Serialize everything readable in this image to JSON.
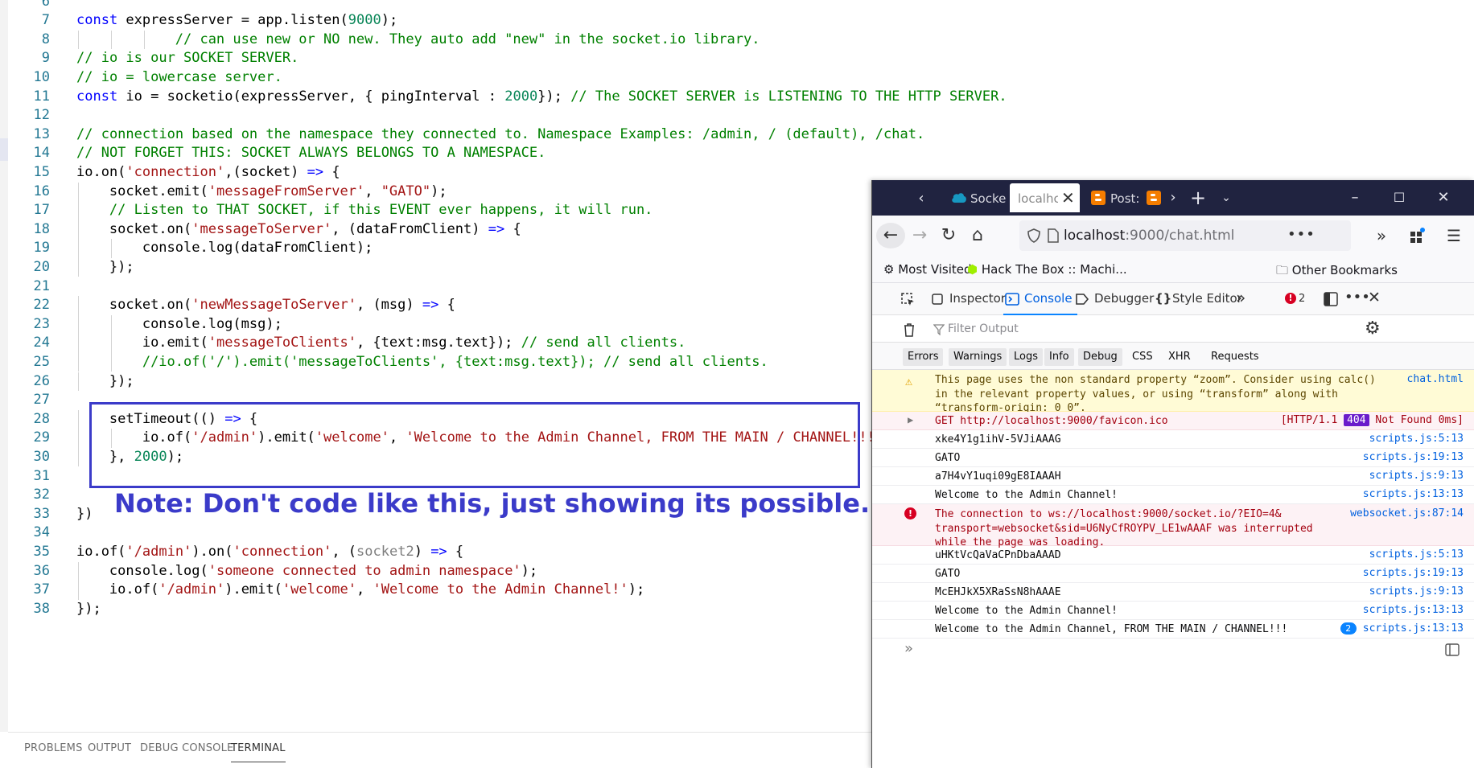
{
  "editor": {
    "lines": [
      {
        "num": "6",
        "indent": 0,
        "segments": []
      },
      {
        "num": "7",
        "indent": 0,
        "segments": [
          {
            "t": "const",
            "c": "kw"
          },
          {
            "t": " expressServer = app.listen(",
            "c": ""
          },
          {
            "t": "9000",
            "c": "num"
          },
          {
            "t": ");",
            "c": ""
          }
        ]
      },
      {
        "num": "8",
        "indent": 3,
        "segments": [
          {
            "t": "// can use new or NO new. They auto add \"new\" in the socket.io library.",
            "c": "cm"
          }
        ]
      },
      {
        "num": "9",
        "indent": 0,
        "segments": [
          {
            "t": "// io is our SOCKET SERVER.",
            "c": "cm"
          }
        ]
      },
      {
        "num": "10",
        "indent": 0,
        "segments": [
          {
            "t": "// io = lowercase server.",
            "c": "cm"
          }
        ]
      },
      {
        "num": "11",
        "indent": 0,
        "segments": [
          {
            "t": "const",
            "c": "kw"
          },
          {
            "t": " io = socketio(expressServer, { pingInterval : ",
            "c": ""
          },
          {
            "t": "2000",
            "c": "num"
          },
          {
            "t": "}); ",
            "c": ""
          },
          {
            "t": "// The SOCKET SERVER is LISTENING TO THE HTTP SERVER.",
            "c": "cm"
          }
        ]
      },
      {
        "num": "12",
        "indent": 0,
        "segments": []
      },
      {
        "num": "13",
        "indent": 0,
        "segments": [
          {
            "t": "// connection based on the namespace they connected to. Namespace Examples: /admin, / (default), /chat.",
            "c": "cm"
          }
        ]
      },
      {
        "num": "14",
        "indent": 0,
        "segments": [
          {
            "t": "// NOT FORGET THIS: SOCKET ALWAYS BELONGS TO A NAMESPACE.",
            "c": "cm"
          }
        ]
      },
      {
        "num": "15",
        "indent": 0,
        "segments": [
          {
            "t": "io.on(",
            "c": ""
          },
          {
            "t": "'connection'",
            "c": "str"
          },
          {
            "t": ",(socket) ",
            "c": ""
          },
          {
            "t": "=>",
            "c": "kw"
          },
          {
            "t": " {",
            "c": ""
          }
        ]
      },
      {
        "num": "16",
        "indent": 1,
        "segments": [
          {
            "t": "socket.emit(",
            "c": ""
          },
          {
            "t": "'messageFromServer'",
            "c": "str"
          },
          {
            "t": ", ",
            "c": ""
          },
          {
            "t": "\"GATO\"",
            "c": "str"
          },
          {
            "t": ");",
            "c": ""
          }
        ]
      },
      {
        "num": "17",
        "indent": 1,
        "segments": [
          {
            "t": "// Listen to THAT SOCKET, if this EVENT ever happens, it will run.",
            "c": "cm"
          }
        ]
      },
      {
        "num": "18",
        "indent": 1,
        "segments": [
          {
            "t": "socket.on(",
            "c": ""
          },
          {
            "t": "'messageToServer'",
            "c": "str"
          },
          {
            "t": ", (dataFromClient) ",
            "c": ""
          },
          {
            "t": "=>",
            "c": "kw"
          },
          {
            "t": " {",
            "c": ""
          }
        ]
      },
      {
        "num": "19",
        "indent": 2,
        "segments": [
          {
            "t": "console.log(dataFromClient);",
            "c": ""
          }
        ]
      },
      {
        "num": "20",
        "indent": 1,
        "segments": [
          {
            "t": "});",
            "c": ""
          }
        ]
      },
      {
        "num": "21",
        "indent": 0,
        "segments": []
      },
      {
        "num": "22",
        "indent": 1,
        "segments": [
          {
            "t": "socket.on(",
            "c": ""
          },
          {
            "t": "'newMessageToServer'",
            "c": "str"
          },
          {
            "t": ", (msg) ",
            "c": ""
          },
          {
            "t": "=>",
            "c": "kw"
          },
          {
            "t": " {",
            "c": ""
          }
        ]
      },
      {
        "num": "23",
        "indent": 2,
        "segments": [
          {
            "t": "console.log(msg);",
            "c": ""
          }
        ]
      },
      {
        "num": "24",
        "indent": 2,
        "segments": [
          {
            "t": "io.emit(",
            "c": ""
          },
          {
            "t": "'messageToClients'",
            "c": "str"
          },
          {
            "t": ", {text:msg.text}); ",
            "c": ""
          },
          {
            "t": "// send all clients.",
            "c": "cm"
          }
        ]
      },
      {
        "num": "25",
        "indent": 2,
        "segments": [
          {
            "t": "//io.of('/').emit('messageToClients', {text:msg.text}); // send all clients.",
            "c": "cm"
          }
        ]
      },
      {
        "num": "26",
        "indent": 1,
        "segments": [
          {
            "t": "});",
            "c": ""
          }
        ]
      },
      {
        "num": "27",
        "indent": 0,
        "segments": []
      },
      {
        "num": "28",
        "indent": 1,
        "segments": [
          {
            "t": "setTimeout(() ",
            "c": ""
          },
          {
            "t": "=>",
            "c": "kw"
          },
          {
            "t": " {",
            "c": ""
          }
        ]
      },
      {
        "num": "29",
        "indent": 2,
        "segments": [
          {
            "t": "io.of(",
            "c": ""
          },
          {
            "t": "'/admin'",
            "c": "str"
          },
          {
            "t": ").emit(",
            "c": ""
          },
          {
            "t": "'welcome'",
            "c": "str"
          },
          {
            "t": ", ",
            "c": ""
          },
          {
            "t": "'Welcome to the Admin Channel, FROM THE MAIN / CHANNEL!!!'",
            "c": "str"
          },
          {
            "t": ");",
            "c": ""
          }
        ]
      },
      {
        "num": "30",
        "indent": 1,
        "segments": [
          {
            "t": "}, ",
            "c": ""
          },
          {
            "t": "2000",
            "c": "num"
          },
          {
            "t": ");",
            "c": ""
          }
        ]
      },
      {
        "num": "31",
        "indent": 0,
        "segments": []
      },
      {
        "num": "32",
        "indent": 0,
        "segments": []
      },
      {
        "num": "33",
        "indent": 0,
        "segments": [
          {
            "t": "})",
            "c": ""
          }
        ]
      },
      {
        "num": "34",
        "indent": 0,
        "segments": []
      },
      {
        "num": "35",
        "indent": 0,
        "segments": [
          {
            "t": "io.of(",
            "c": ""
          },
          {
            "t": "'/admin'",
            "c": "str"
          },
          {
            "t": ").on(",
            "c": ""
          },
          {
            "t": "'connection'",
            "c": "str"
          },
          {
            "t": ", (",
            "c": ""
          },
          {
            "t": "socket2",
            "c": "dim"
          },
          {
            "t": ") ",
            "c": ""
          },
          {
            "t": "=>",
            "c": "kw"
          },
          {
            "t": " {",
            "c": ""
          }
        ]
      },
      {
        "num": "36",
        "indent": 1,
        "segments": [
          {
            "t": "console.log(",
            "c": ""
          },
          {
            "t": "'someone connected to admin namespace'",
            "c": "str"
          },
          {
            "t": ");",
            "c": ""
          }
        ]
      },
      {
        "num": "37",
        "indent": 1,
        "segments": [
          {
            "t": "io.of(",
            "c": ""
          },
          {
            "t": "'/admin'",
            "c": "str"
          },
          {
            "t": ").emit(",
            "c": ""
          },
          {
            "t": "'welcome'",
            "c": "str"
          },
          {
            "t": ", ",
            "c": ""
          },
          {
            "t": "'Welcome to the Admin Channel!'",
            "c": "str"
          },
          {
            "t": ");",
            "c": ""
          }
        ]
      },
      {
        "num": "38",
        "indent": 0,
        "segments": [
          {
            "t": "});",
            "c": ""
          }
        ]
      }
    ],
    "note": "Note: Don't code like this, just showing its possible."
  },
  "panel": {
    "tabs": [
      "PROBLEMS",
      "OUTPUT",
      "DEBUG CONSOLE",
      "TERMINAL"
    ],
    "active": "TERMINAL"
  },
  "browser": {
    "tabs": [
      {
        "label": "Socke",
        "icon": "salesforce-cloud-icon"
      },
      {
        "label": "localhc",
        "icon": "none",
        "active": true
      },
      {
        "label": "Post: E",
        "icon": "blogger-icon"
      },
      {
        "label": "",
        "icon": "blogger-icon"
      }
    ],
    "url_host": "localhost",
    "url_rest": ":9000/chat.html",
    "bookmarks": {
      "most_visited": "Most Visited",
      "htb": "Hack The Box :: Machi...",
      "other": "Other Bookmarks"
    },
    "devtools": {
      "tabs": [
        "Inspector",
        "Console",
        "Debugger",
        "Style Editor"
      ],
      "active_tab": "Console",
      "error_count": "2",
      "filter_placeholder": "Filter Output",
      "levels": [
        "Errors",
        "Warnings",
        "Logs",
        "Info",
        "Debug"
      ],
      "extra_filters": [
        "CSS",
        "XHR",
        "Requests"
      ]
    },
    "console": [
      {
        "type": "warn",
        "text": "This page uses the non standard property “zoom”. Consider using calc()\nin the relevant property values, or using “transform” along with\n“transform-origin: 0 0”.",
        "source": "chat.html"
      },
      {
        "type": "net-error",
        "text": "GET http://localhost:9000/favicon.ico",
        "status_pre": "[HTTP/1.1 ",
        "status_code": "404",
        "status_post": " Not Found 0ms]"
      },
      {
        "type": "log",
        "text": "xke4Y1g1ihV-5VJiAAAG",
        "source": "scripts.js:5:13"
      },
      {
        "type": "log",
        "text": "GATO",
        "source": "scripts.js:19:13"
      },
      {
        "type": "log",
        "text": "a7H4vY1uqi09gE8IAAAH",
        "source": "scripts.js:9:13"
      },
      {
        "type": "log",
        "text": "Welcome to the Admin Channel!",
        "source": "scripts.js:13:13"
      },
      {
        "type": "error",
        "text": "The connection to ws://localhost:9000/socket.io/?EIO=4&\ntransport=websocket&sid=U6NyCfROYPV_LE1wAAAF was interrupted\nwhile the page was loading.",
        "source": "websocket.js:87:14"
      },
      {
        "type": "log",
        "text": "uHKtVcQaVaCPnDbaAAAD",
        "source": "scripts.js:5:13"
      },
      {
        "type": "log",
        "text": "GATO",
        "source": "scripts.js:19:13"
      },
      {
        "type": "log",
        "text": "McEHJkX5XRaSsN8hAAAE",
        "source": "scripts.js:9:13"
      },
      {
        "type": "log",
        "text": "Welcome to the Admin Channel!",
        "source": "scripts.js:13:13"
      },
      {
        "type": "log",
        "text": "Welcome to the Admin Channel, FROM THE MAIN / CHANNEL!!!",
        "source": "scripts.js:13:13",
        "repeat": "2"
      }
    ],
    "prompt": "»"
  },
  "colors": {
    "keyword": "#0000ff",
    "comment": "#008000",
    "string": "#a31515",
    "number": "#098658",
    "line_number": "#237893",
    "note": "#3b3bc9",
    "titlebar": "#202340",
    "accent": "#0a84ff"
  }
}
